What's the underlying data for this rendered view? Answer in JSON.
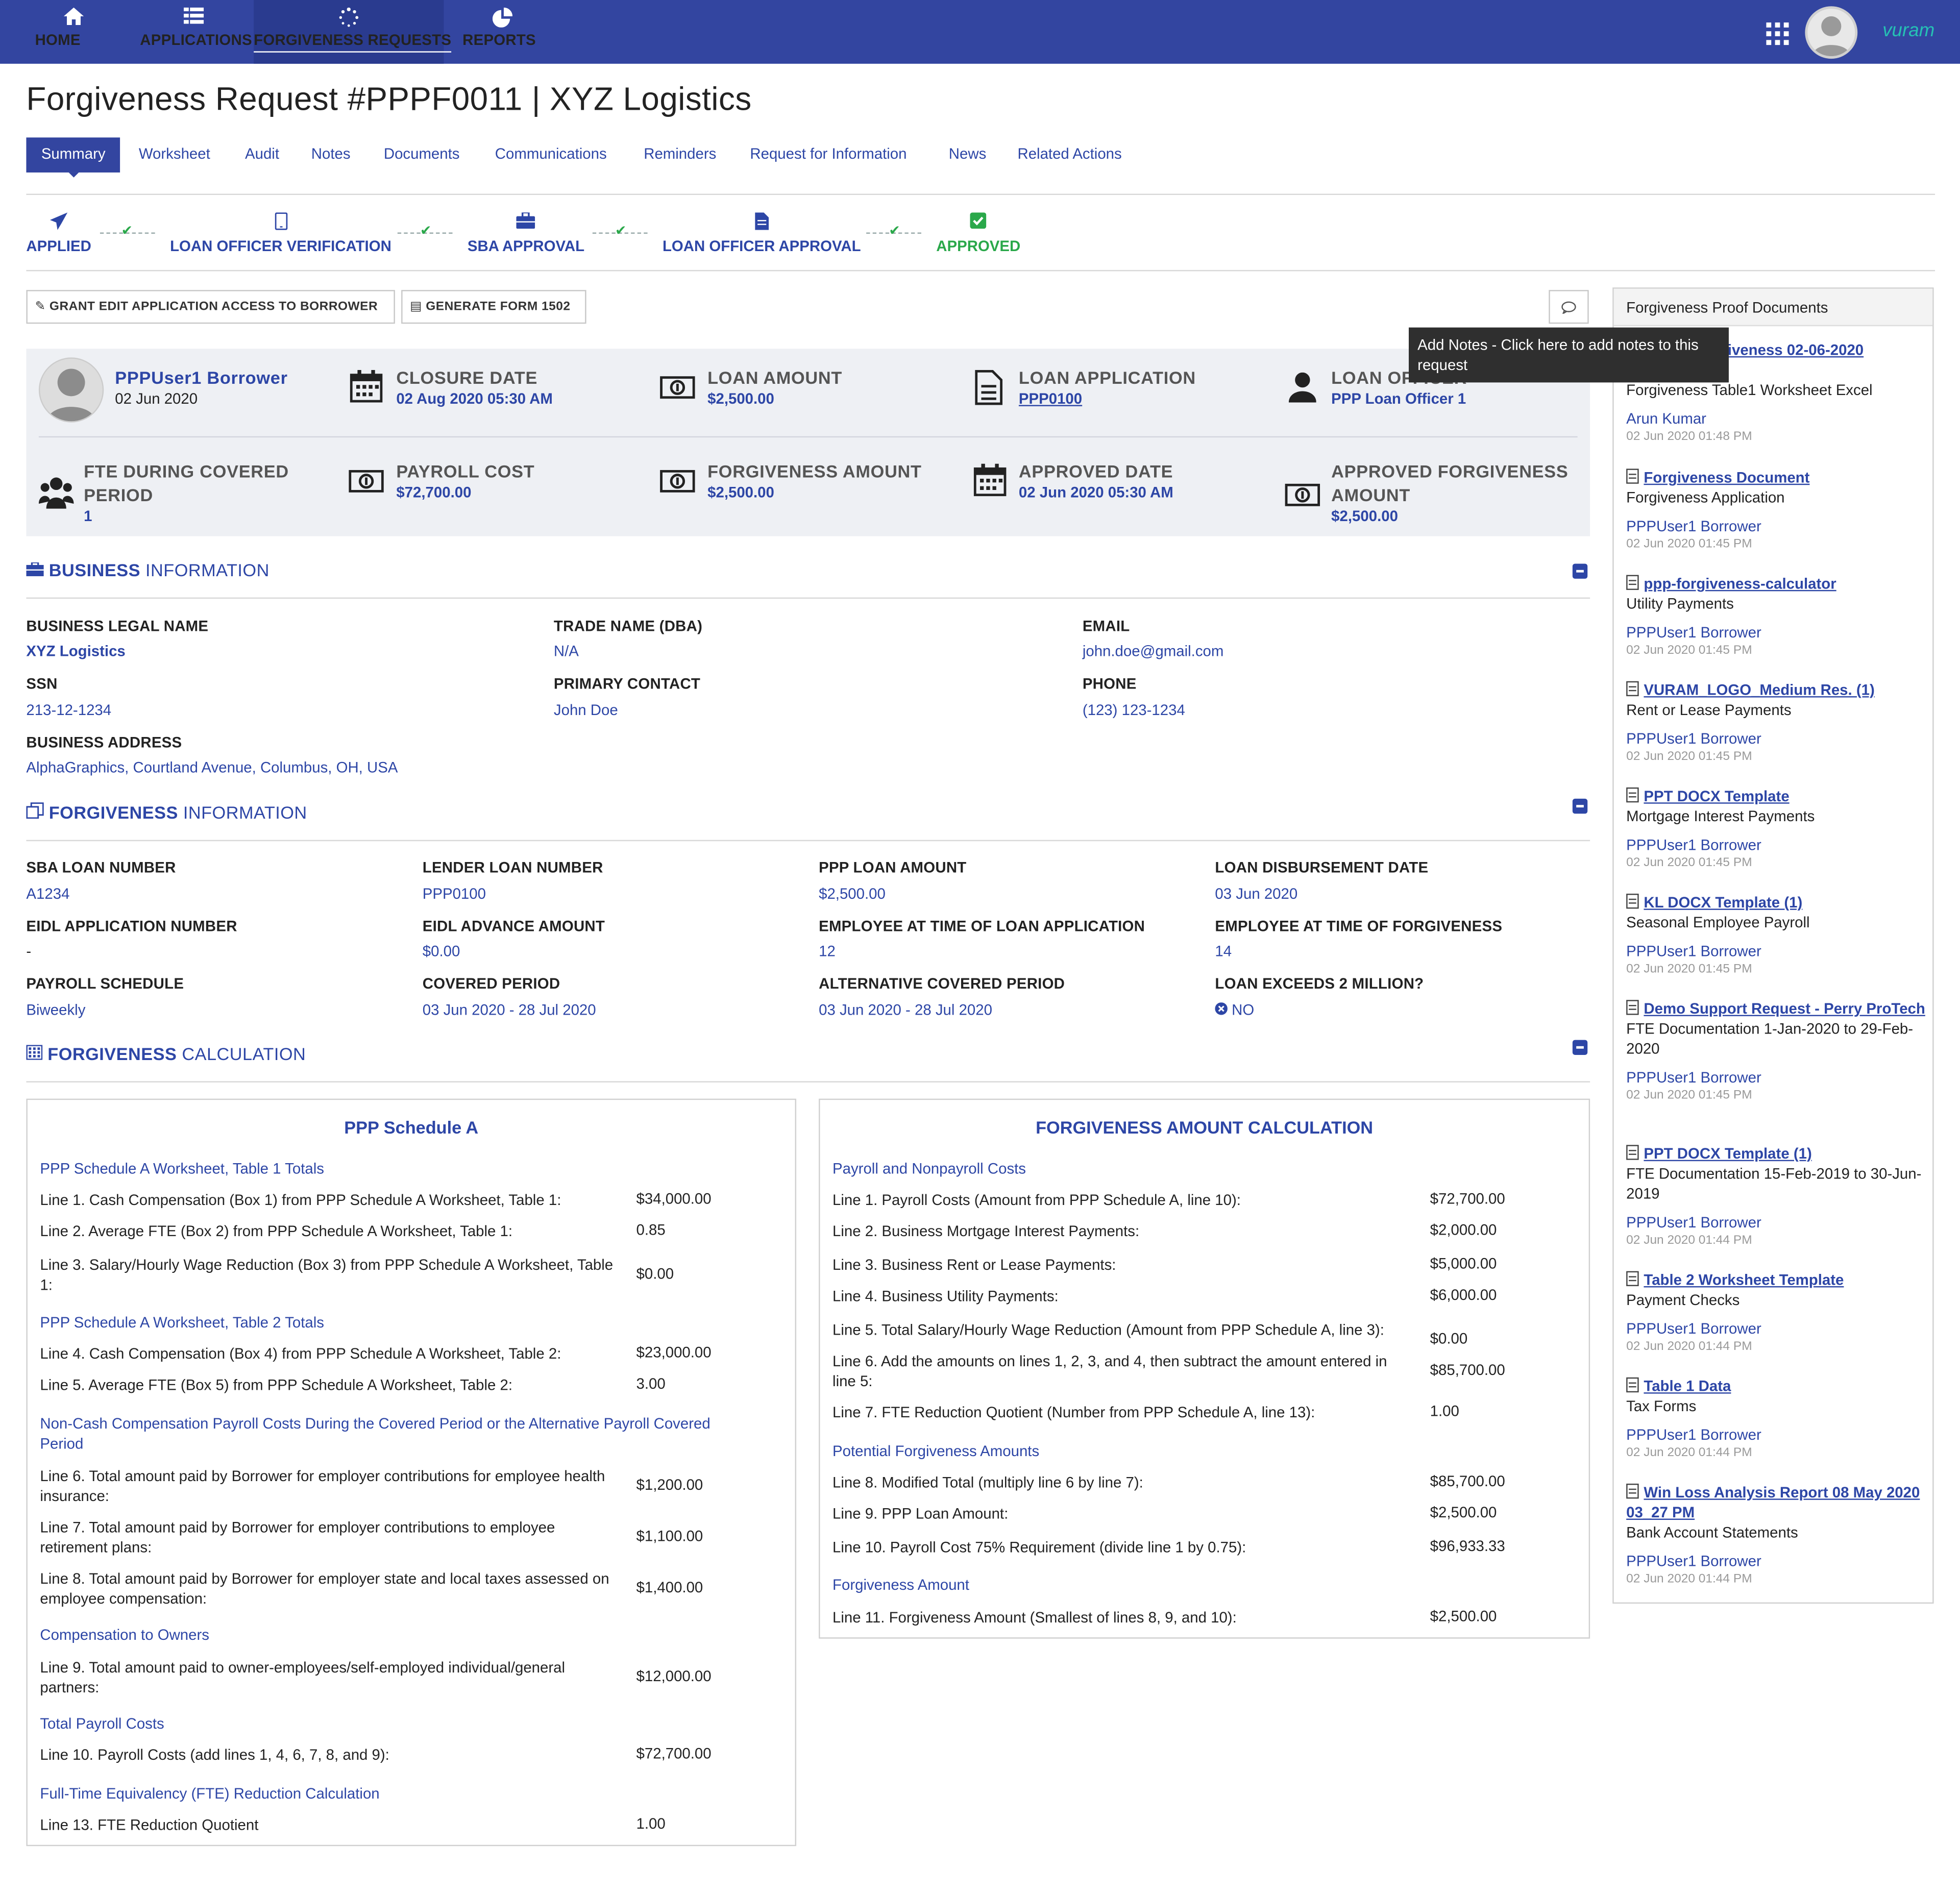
{
  "nav": {
    "items": [
      {
        "label": "HOME",
        "icon": "home-icon"
      },
      {
        "label": "APPLICATIONS",
        "icon": "list-icon"
      },
      {
        "label": "FORGIVENESS REQUESTS",
        "icon": "spinner-icon"
      },
      {
        "label": "REPORTS",
        "icon": "pie-chart-icon"
      }
    ],
    "active": "FORGIVENESS REQUESTS",
    "logo": "vuram"
  },
  "page": {
    "title": "Forgiveness Request #PPPF0011 | XYZ Logistics"
  },
  "tabs": [
    "Summary",
    "Worksheet",
    "Audit",
    "Notes",
    "Documents",
    "Communications",
    "Reminders",
    "Request for Information",
    "News",
    "Related Actions"
  ],
  "steps": [
    "APPLIED",
    "LOAN OFFICER VERIFICATION",
    "SBA APPROVAL",
    "LOAN OFFICER APPROVAL",
    "APPROVED"
  ],
  "buttons": {
    "grant": "GRANT EDIT APPLICATION ACCESS TO BORROWER",
    "generate": "GENERATE FORM 1502",
    "tooltip": "Add Notes - Click here to add notes to this request"
  },
  "summary": {
    "borrower_name": "PPPUser1 Borrower",
    "borrower_date": "02 Jun 2020",
    "closure_date_t": "CLOSURE DATE",
    "closure_date_v": "02 Aug 2020 05:30 AM",
    "loan_amount_t": "LOAN AMOUNT",
    "loan_amount_v": "$2,500.00",
    "loan_app_t": "LOAN APPLICATION",
    "loan_app_v": "PPP0100",
    "loan_officer_t": "LOAN OFFICER",
    "loan_officer_v": "PPP Loan Officer 1",
    "fte_t": "FTE DURING COVERED PERIOD",
    "fte_v": "1",
    "payroll_t": "PAYROLL COST",
    "payroll_v": "$72,700.00",
    "forgiveness_t": "FORGIVENESS AMOUNT",
    "forgiveness_v": "$2,500.00",
    "approved_date_t": "APPROVED DATE",
    "approved_date_v": "02 Jun 2020 05:30 AM",
    "approved_forg_t": "APPROVED FORGIVENESS AMOUNT",
    "approved_forg_v": "$2,500.00"
  },
  "business": {
    "title_bold": "BUSINESS",
    "title_rest": " INFORMATION",
    "legal_name_l": "BUSINESS LEGAL NAME",
    "legal_name_v": "XYZ Logistics",
    "trade_l": "TRADE NAME (DBA)",
    "trade_v": "N/A",
    "email_l": "EMAIL",
    "email_v": "john.doe@gmail.com",
    "ssn_l": "SSN",
    "ssn_v": "213-12-1234",
    "contact_l": "PRIMARY CONTACT",
    "contact_v": "John Doe",
    "phone_l": "PHONE",
    "phone_v": "(123) 123-1234",
    "address_l": "BUSINESS ADDRESS",
    "address_v": "AlphaGraphics, Courtland Avenue, Columbus, OH, USA"
  },
  "forgiveness_info": {
    "title_bold": "FORGIVENESS",
    "title_rest": " INFORMATION",
    "sba_l": "SBA LOAN NUMBER",
    "sba_v": "A1234",
    "lender_l": "LENDER LOAN NUMBER",
    "lender_v": "PPP0100",
    "ppp_amt_l": "PPP LOAN AMOUNT",
    "ppp_amt_v": "$2,500.00",
    "disb_l": "LOAN DISBURSEMENT DATE",
    "disb_v": "03 Jun 2020",
    "eidl_num_l": "EIDL APPLICATION NUMBER",
    "eidl_num_v": "-",
    "eidl_adv_l": "EIDL ADVANCE AMOUNT",
    "eidl_adv_v": "$0.00",
    "emp_app_l": "EMPLOYEE AT TIME OF LOAN APPLICATION",
    "emp_app_v": "12",
    "emp_forg_l": "EMPLOYEE AT TIME OF FORGIVENESS",
    "emp_forg_v": "14",
    "sched_l": "PAYROLL SCHEDULE",
    "sched_v": "Biweekly",
    "covered_l": "COVERED PERIOD",
    "covered_v": "03 Jun 2020 - 28 Jul 2020",
    "alt_l": "ALTERNATIVE COVERED PERIOD",
    "alt_v": "03 Jun 2020 - 28 Jul 2020",
    "exceeds_l": "LOAN EXCEEDS 2 MILLION?",
    "exceeds_v": "NO"
  },
  "calc": {
    "title_bold": "FORGIVENESS",
    "title_rest": " CALCULATION",
    "schedA": {
      "title": "PPP Schedule A",
      "rows": [
        {
          "kind": "head",
          "text": "PPP Schedule A Worksheet, Table 1 Totals"
        },
        {
          "kind": "line",
          "text": "Line 1. Cash Compensation (Box 1) from PPP Schedule A Worksheet, Table 1:",
          "amount": "$34,000.00"
        },
        {
          "kind": "line",
          "text": "Line 2. Average FTE (Box 2) from PPP Schedule A Worksheet, Table 1:",
          "amount": "0.85"
        },
        {
          "kind": "line",
          "text": "Line 3. Salary/Hourly Wage Reduction (Box 3) from PPP Schedule A Worksheet, Table 1:",
          "amount": "$0.00"
        },
        {
          "kind": "head",
          "text": "PPP Schedule A Worksheet, Table 2 Totals"
        },
        {
          "kind": "line",
          "text": "Line 4. Cash Compensation (Box 4) from PPP Schedule A Worksheet, Table 2:",
          "amount": "$23,000.00"
        },
        {
          "kind": "line",
          "text": "Line 5. Average FTE (Box 5) from PPP Schedule A Worksheet, Table 2:",
          "amount": "3.00"
        },
        {
          "kind": "head",
          "text": "Non-Cash Compensation Payroll Costs During the Covered Period or the Alternative Payroll Covered Period"
        },
        {
          "kind": "line",
          "text": "Line 6. Total amount paid by Borrower for employer contributions for employee health insurance:",
          "amount": "$1,200.00"
        },
        {
          "kind": "line",
          "text": "Line 7. Total amount paid by Borrower for employer contributions to employee retirement plans:",
          "amount": "$1,100.00"
        },
        {
          "kind": "line",
          "text": "Line 8. Total amount paid by Borrower for employer state and local taxes assessed on employee compensation:",
          "amount": "$1,400.00"
        },
        {
          "kind": "head",
          "text": "Compensation to Owners"
        },
        {
          "kind": "line",
          "text": "Line 9. Total amount paid to owner-employees/self-employed individual/general partners:",
          "amount": "$12,000.00"
        },
        {
          "kind": "head",
          "text": "Total Payroll Costs"
        },
        {
          "kind": "line",
          "text": "Line 10. Payroll Costs (add lines 1, 4, 6, 7, 8, and 9):",
          "amount": "$72,700.00"
        },
        {
          "kind": "head",
          "text": "Full-Time Equivalency (FTE) Reduction Calculation"
        },
        {
          "kind": "line",
          "text": "Line 13. FTE Reduction Quotient",
          "amount": "1.00"
        }
      ]
    },
    "amount": {
      "title": "FORGIVENESS AMOUNT CALCULATION",
      "rows": [
        {
          "kind": "head",
          "text": "Payroll and Nonpayroll Costs"
        },
        {
          "kind": "line",
          "text": "Line 1. Payroll Costs (Amount from PPP Schedule A, line 10):",
          "amount": "$72,700.00"
        },
        {
          "kind": "line",
          "text": "Line 2. Business Mortgage Interest Payments:",
          "amount": "$2,000.00"
        },
        {
          "kind": "line",
          "text": "Line 3. Business Rent or Lease Payments:",
          "amount": "$5,000.00"
        },
        {
          "kind": "line",
          "text": "Line 4. Business Utility Payments:",
          "amount": "$6,000.00"
        },
        {
          "kind": "line",
          "text": "Line 5. Total Salary/Hourly Wage Reduction (Amount from PPP Schedule A, line 3):",
          "amount": "$0.00"
        },
        {
          "kind": "line",
          "text": "Line 6. Add the amounts on lines 1, 2, 3, and 4, then subtract the amount entered in line 5:",
          "amount": "$85,700.00"
        },
        {
          "kind": "line",
          "text": "Line 7. FTE Reduction Quotient (Number from PPP Schedule A, line 13):",
          "amount": "1.00"
        },
        {
          "kind": "head",
          "text": "Potential Forgiveness Amounts"
        },
        {
          "kind": "line",
          "text": "Line 8. Modified Total (multiply line 6 by line 7):",
          "amount": "$85,700.00"
        },
        {
          "kind": "line",
          "text": "Line 9. PPP Loan Amount:",
          "amount": "$2,500.00"
        },
        {
          "kind": "line",
          "text": "Line 10. Payroll Cost 75% Requirement (divide line 1 by 0.75):",
          "amount": "$96,933.33"
        },
        {
          "kind": "head",
          "text": "Forgiveness Amount"
        },
        {
          "kind": "line",
          "text": "Line 11. Forgiveness Amount (Smallest of lines 8, 9, and 10):",
          "amount": "$2,500.00"
        }
      ]
    }
  },
  "proof_docs": {
    "title": "Forgiveness Proof Documents",
    "items": [
      {
        "name": "Table1 Forgiveness 02-06-2020 13_48_12",
        "category": "Forgiveness Table1 Worksheet Excel",
        "user": "Arun Kumar",
        "time": "02 Jun 2020 01:48 PM"
      },
      {
        "name": "Forgiveness Document",
        "category": "Forgiveness Application",
        "user": "PPPUser1 Borrower",
        "time": "02 Jun 2020 01:45 PM"
      },
      {
        "name": "ppp-forgiveness-calculator",
        "category": "Utility Payments",
        "user": "PPPUser1 Borrower",
        "time": "02 Jun 2020 01:45 PM"
      },
      {
        "name": "VURAM_LOGO_Medium Res. (1)",
        "category": "Rent or Lease Payments",
        "user": "PPPUser1 Borrower",
        "time": "02 Jun 2020 01:45 PM"
      },
      {
        "name": "PPT DOCX Template",
        "category": "Mortgage Interest Payments",
        "user": "PPPUser1 Borrower",
        "time": "02 Jun 2020 01:45 PM"
      },
      {
        "name": "KL DOCX Template (1)",
        "category": "Seasonal Employee Payroll",
        "user": "PPPUser1 Borrower",
        "time": "02 Jun 2020 01:45 PM"
      },
      {
        "name": "Demo Support Request - Perry ProTech",
        "category": "FTE Documentation 1-Jan-2020 to 29-Feb-2020",
        "user": "PPPUser1 Borrower",
        "time": "02 Jun 2020 01:45 PM"
      },
      {
        "name": "PPT DOCX Template (1)",
        "category": "FTE Documentation 15-Feb-2019 to 30-Jun-2019",
        "user": "PPPUser1 Borrower",
        "time": "02 Jun 2020 01:44 PM"
      },
      {
        "name": "Table 2 Worksheet Template",
        "category": "Payment Checks",
        "user": "PPPUser1 Borrower",
        "time": "02 Jun 2020 01:44 PM"
      },
      {
        "name": "Table 1 Data",
        "category": "Tax Forms",
        "user": "PPPUser1 Borrower",
        "time": "02 Jun 2020 01:44 PM"
      },
      {
        "name": "Win Loss Analysis Report 08 May 2020 03_27 PM",
        "category": "Bank Account Statements",
        "user": "PPPUser1 Borrower",
        "time": "02 Jun 2020 01:44 PM"
      }
    ]
  },
  "colors": {
    "nav": "#3345a0",
    "link": "#2d46a6",
    "approved": "#2aa84a",
    "summary_bg": "#eef0f4"
  }
}
